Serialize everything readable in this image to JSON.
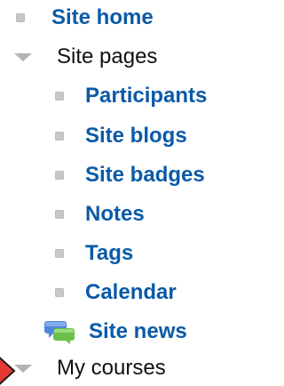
{
  "navigation": {
    "items": [
      {
        "label": "Site home"
      },
      {
        "label": "Site pages"
      },
      {
        "label": "Participants"
      },
      {
        "label": "Site blogs"
      },
      {
        "label": "Site badges"
      },
      {
        "label": "Notes"
      },
      {
        "label": "Tags"
      },
      {
        "label": "Calendar"
      },
      {
        "label": "Site news"
      },
      {
        "label": "My courses"
      }
    ]
  },
  "colors": {
    "link": "#0a5aa8",
    "text": "#111111",
    "bullet": "#c7c7c7",
    "triangle": "#b3b3b3",
    "marker": "#e53935"
  },
  "icons": {
    "bullet": "bullet-icon",
    "expanded": "expand-triangle-icon",
    "forum": "forum-chat-icon",
    "pointer": "pointer-marker-icon"
  }
}
